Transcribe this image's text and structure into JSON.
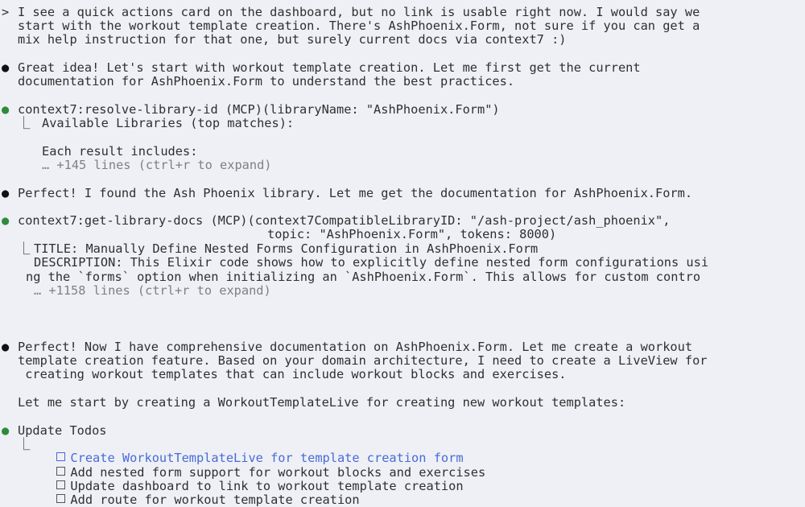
{
  "user_message": {
    "prompt": ">",
    "lines": [
      "I see a quick actions card on the dashboard, but no link is usable right now. I would say we",
      "start with the workout template creation. There's AshPhoenix.Form, not sure if you can get a",
      "mix help instruction for that one, but surely current docs via context7 :)"
    ]
  },
  "msg1": {
    "bullet": "●",
    "lines": [
      "Great idea! Let's start with workout template creation. Let me first get the current",
      "documentation for AshPhoenix.Form to understand the best practices."
    ]
  },
  "tool1": {
    "bullet": "●",
    "call": "context7:resolve-library-id (MCP)(libraryName: \"AshPhoenix.Form\")",
    "result_marker": "⎿",
    "result_line": "Available Libraries (top matches):",
    "result_line2": "Each result includes:",
    "expand": "… +145 lines (ctrl+r to expand)"
  },
  "msg2": {
    "bullet": "●",
    "text": "Perfect! I found the Ash Phoenix library. Let me get the documentation for AshPhoenix.Form."
  },
  "tool2": {
    "bullet": "●",
    "call_line1": "context7:get-library-docs (MCP)(context7CompatibleLibraryID: \"/ash-project/ash_phoenix\",",
    "call_line2": "topic: \"AshPhoenix.Form\", tokens: 8000)",
    "result_marker": "⎿",
    "result_line1": "TITLE: Manually Define Nested Forms Configuration in AshPhoenix.Form",
    "result_line2": "DESCRIPTION: This Elixir code shows how to explicitly define nested form configurations usi",
    "result_line3": "ng the `forms` option when initializing an `AshPhoenix.Form`. This allows for custom contro",
    "expand": "… +1158 lines (ctrl+r to expand)"
  },
  "msg3": {
    "bullet": "●",
    "lines": [
      "Perfect! Now I have comprehensive documentation on AshPhoenix.Form. Let me create a workout",
      "template creation feature. Based on your domain architecture, I need to create a LiveView for",
      " creating workout templates that can include workout blocks and exercises."
    ],
    "followup": "Let me start by creating a WorkoutTemplateLive for creating new workout templates:"
  },
  "todos": {
    "bullet": "●",
    "title": "Update Todos",
    "marker": "⎿",
    "items": [
      "Create WorkoutTemplateLive for template creation form",
      "Add nested form support for workout blocks and exercises",
      "Update dashboard to link to workout template creation",
      "Add route for workout template creation"
    ]
  },
  "colors": {
    "background": "#eef0f6",
    "text": "#2f2f2f",
    "muted": "#808080",
    "green_bullet": "#2f8a3c",
    "active_todo": "#4a6ad6"
  }
}
